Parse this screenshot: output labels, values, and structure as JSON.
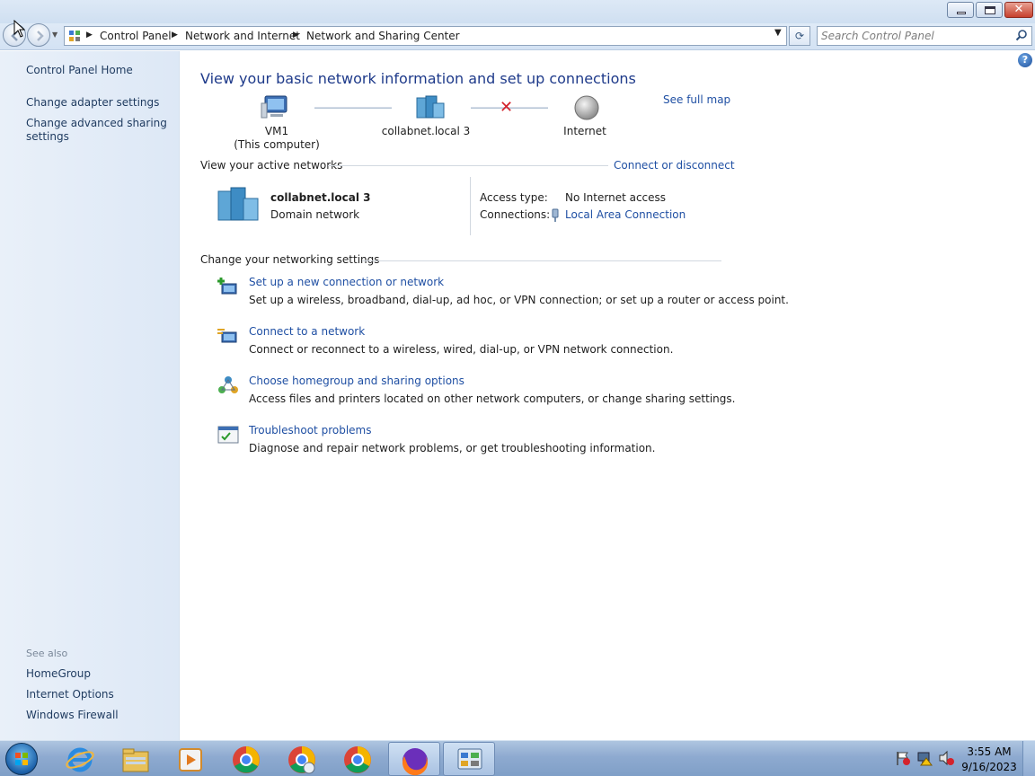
{
  "window": {
    "minimize_icon": "minimize-icon",
    "maximize_icon": "restore-icon",
    "close_label": "✕"
  },
  "navbar": {
    "breadcrumbs": [
      "Control Panel",
      "Network and Internet",
      "Network and Sharing Center"
    ],
    "search_placeholder": "Search Control Panel",
    "refresh_label": "⟳"
  },
  "left_pane": {
    "home": "Control Panel Home",
    "links": [
      "Change adapter settings",
      "Change advanced sharing settings"
    ],
    "see_also_heading": "See also",
    "see_also": [
      "HomeGroup",
      "Internet Options",
      "Windows Firewall"
    ]
  },
  "main": {
    "title": "View your basic network information and set up connections",
    "see_full_map": "See full map",
    "map": {
      "computer_name": "VM1",
      "computer_sub": "(This computer)",
      "network_name": "collabnet.local  3",
      "internet": "Internet",
      "status": "disconnected"
    },
    "active_networks_heading": "View your active networks",
    "connect_or_disconnect": "Connect or disconnect",
    "active_network": {
      "name": "collabnet.local  3",
      "category": "Domain network",
      "access_type_label": "Access type:",
      "access_type": "No Internet access",
      "connections_label": "Connections:",
      "connection": "Local Area Connection"
    },
    "settings_heading": "Change your networking settings",
    "tasks": [
      {
        "title": "Set up a new connection or network",
        "desc": "Set up a wireless, broadband, dial-up, ad hoc, or VPN connection; or set up a router or access point.",
        "icon": "new-connection-icon"
      },
      {
        "title": "Connect to a network",
        "desc": "Connect or reconnect to a wireless, wired, dial-up, or VPN network connection.",
        "icon": "connect-network-icon"
      },
      {
        "title": "Choose homegroup and sharing options",
        "desc": "Access files and printers located on other network computers, or change sharing settings.",
        "icon": "homegroup-icon"
      },
      {
        "title": "Troubleshoot problems",
        "desc": "Diagnose and repair network problems, or get troubleshooting information.",
        "icon": "troubleshoot-icon"
      }
    ],
    "help_label": "?"
  },
  "taskbar": {
    "pinned": [
      "internet-explorer-icon",
      "windows-explorer-icon",
      "media-player-icon",
      "chrome-icon",
      "chrome-profile-icon",
      "chrome-icon",
      "firefox-icon",
      "control-panel-icon"
    ],
    "time": "3:55 AM",
    "date": "9/16/2023"
  }
}
